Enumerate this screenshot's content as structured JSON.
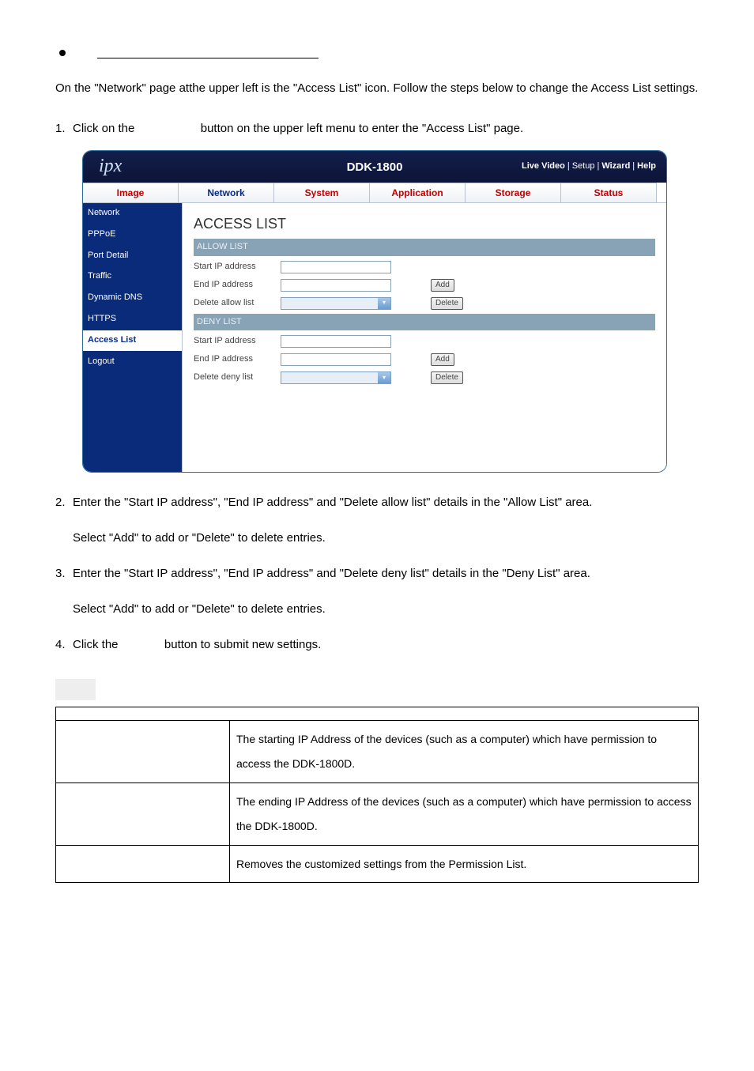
{
  "intro": "On the \"Network\" page atthe upper left is the \"Access List\" icon. Follow the steps below to change the Access List settings.",
  "steps": {
    "s1_a": "Click on the",
    "s1_b": "button on the upper left menu to enter the \"Access List\" page.",
    "s2": "Enter the \"Start IP address\", \"End IP address\" and \"Delete allow list\" details in the \"Allow List\" area.",
    "s2b": "Select \"Add\" to add or \"Delete\" to delete entries.",
    "s3": "Enter the \"Start IP address\", \"End IP address\" and \"Delete deny list\" details in the \"Deny List\" area.",
    "s3b": "Select \"Add\" to add or \"Delete\" to delete entries.",
    "s4_a": "Click the",
    "s4_b": "button to submit new settings."
  },
  "screenshot": {
    "logo": "ipx",
    "title": "DDK-1800",
    "links": {
      "live": "Live Video",
      "setup": "Setup",
      "wizard": "Wizard",
      "help": "Help"
    },
    "tabs": [
      "Image",
      "Network",
      "System",
      "Application",
      "Storage",
      "Status"
    ],
    "side": [
      "Network",
      "PPPoE",
      "Port Detail",
      "Traffic",
      "Dynamic DNS",
      "HTTPS",
      "Access List",
      "Logout"
    ],
    "heading": "ACCESS LIST",
    "allow_h": "ALLOW LIST",
    "deny_h": "DENY LIST",
    "labels": {
      "start": "Start IP address",
      "end": "End IP address",
      "del_allow": "Delete allow list",
      "del_deny": "Delete deny list"
    },
    "buttons": {
      "add": "Add",
      "delete": "Delete"
    }
  },
  "table": {
    "r1": "The starting IP Address of the devices (such as a computer) which have permission to access the DDK-1800D.",
    "r2": "The ending IP Address of the devices (such as a computer) which have permission to access the DDK-1800D.",
    "r3": "Removes the customized settings from the Permission List."
  }
}
